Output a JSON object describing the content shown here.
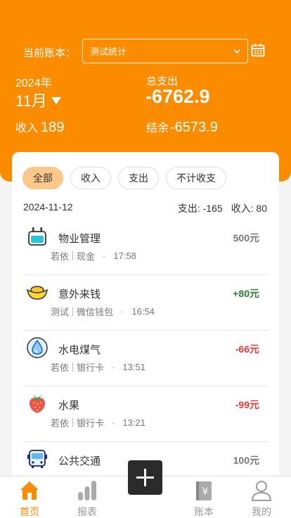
{
  "header": {
    "book_label": "当前账本：",
    "book_value": "测试统计",
    "year": "2024年",
    "month": "11月",
    "expense_label": "总支出",
    "expense_value": "-6762.9",
    "income_label": "收入",
    "income_value": "189",
    "balance_label": "结余",
    "balance_value": "-6573.9"
  },
  "filters": [
    "全部",
    "收入",
    "支出",
    "不计收支"
  ],
  "day": {
    "date": "2024-11-12",
    "expense": "支出: -165",
    "income": "收入: 80"
  },
  "records": [
    {
      "icon": "plug-icon",
      "title": "物业管理",
      "user": "若依",
      "account": "现金",
      "time": "17:58",
      "amount": "500元",
      "tone": "neutral"
    },
    {
      "icon": "gold-ingot-icon",
      "title": "意外来钱",
      "user": "测试",
      "account": "微信钱包",
      "time": "16:54",
      "amount": "+80元",
      "tone": "pos"
    },
    {
      "icon": "water-drop-icon",
      "title": "水电煤气",
      "user": "若依",
      "account": "银行卡",
      "time": "13:51",
      "amount": "-66元",
      "tone": "neg"
    },
    {
      "icon": "strawberry-icon",
      "title": "水果",
      "user": "若依",
      "account": "银行卡",
      "time": "13:21",
      "amount": "-99元",
      "tone": "neg"
    },
    {
      "icon": "bus-icon",
      "title": "公共交通",
      "user": "",
      "account": "",
      "time": "",
      "amount": "100元",
      "tone": "neutral"
    }
  ],
  "tabs": {
    "home": "首页",
    "report": "报表",
    "ledger": "账本",
    "mine": "我的"
  },
  "colors": {
    "brand": "#fb8c00",
    "chip_active": "#fcc88a",
    "positive": "#2e7d32",
    "negative": "#e53935"
  }
}
